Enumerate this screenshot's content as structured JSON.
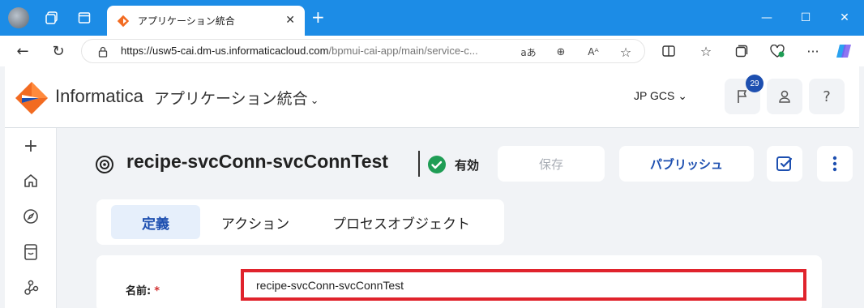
{
  "browser": {
    "tab_title": "アプリケーション統合",
    "url_main": "https://usw5-cai.dm-us.informaticacloud.com",
    "url_rest": "/bpmui-cai-app/main/service-c...",
    "read_aloud_label": "aあ"
  },
  "header": {
    "brand": "Informatica",
    "app_name": "アプリケーション統合",
    "org_name": "JP GCS",
    "notification_count": "29"
  },
  "page": {
    "title": "recipe-svcConn-svcConnTest",
    "status": "有効",
    "save_label": "保存",
    "publish_label": "パブリッシュ"
  },
  "tabs": {
    "definition": "定義",
    "action": "アクション",
    "process_object": "プロセスオブジェクト"
  },
  "form": {
    "name_label": "名前:",
    "required_mark": "*",
    "name_value": "recipe-svcConn-svcConnTest"
  },
  "colors": {
    "titlebar": "#1c8ce6",
    "accent": "#1d4fb0",
    "status_green": "#1f9d55",
    "highlight_red": "#e0232c"
  }
}
